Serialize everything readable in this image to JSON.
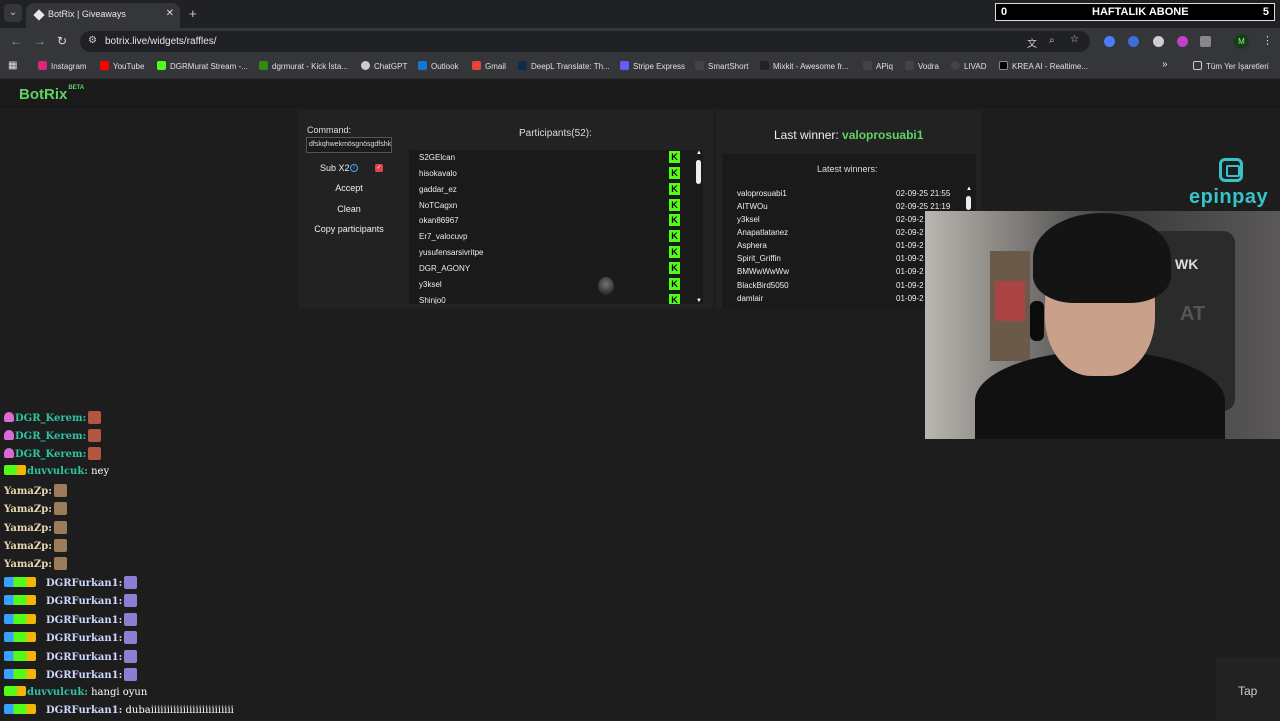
{
  "browser": {
    "tab_title": "BotRix | Giveaways",
    "url": "botrix.live/widgets/raffles/",
    "avatar_letter": "M",
    "bookmarks": [
      {
        "label": "Instagram",
        "color": "#d6297a"
      },
      {
        "label": "YouTube",
        "color": "#ff0000"
      },
      {
        "label": "DGRMurat Stream -...",
        "color": "#53fc18"
      },
      {
        "label": "dgrmurat - Kick İsta...",
        "color": "#53fc18"
      },
      {
        "label": "ChatGPT",
        "color": "#cccccc"
      },
      {
        "label": "Outlook",
        "color": "#0f78d4"
      },
      {
        "label": "Gmail",
        "color": "#ea4335"
      },
      {
        "label": "DeepL Translate: Th...",
        "color": "#0f2b46"
      },
      {
        "label": "Stripe Express",
        "color": "#635bff"
      },
      {
        "label": "SmartShort",
        "color": "#444444"
      },
      {
        "label": "Mixkit - Awesome fr...",
        "color": "#222222"
      },
      {
        "label": "APiq",
        "color": "#444444"
      },
      {
        "label": "Vodra",
        "color": "#444444"
      },
      {
        "label": "LIVAD",
        "color": "#444444"
      },
      {
        "label": "KREA AI - Realtime...",
        "color": "#000000"
      }
    ],
    "all_bookmarks": "Tüm Yer İşaretleri"
  },
  "sub_counter": {
    "left": "0",
    "title": "HAFTALIK ABONE",
    "right": "5"
  },
  "app": {
    "logo": "BotRix",
    "logo_badge": "BETA"
  },
  "raffle": {
    "command_label": "Command:",
    "command_value": "dfskqhwekmösgnösgdfshklk",
    "sub_x2_label": "Sub X2",
    "sub_x2_checked": true,
    "buttons": [
      "Accept",
      "Clean",
      "Copy participants"
    ],
    "participants_title": "Participants(52):",
    "participants": [
      "S2GElcan",
      "hisokavalo",
      "gaddar_ez",
      "NoTCagxn",
      "okan86967",
      "Er7_valocuvp",
      "yusufensarsivritpe",
      "DGR_AGONY",
      "y3ksel",
      "Shinjo0"
    ]
  },
  "winners": {
    "last_winner_label": "Last winner:",
    "last_winner": "valoprosuabi1",
    "latest_title": "Latest winners:",
    "list": [
      {
        "name": "valoprosuabi1",
        "date": "02-09-25 21:55"
      },
      {
        "name": "AITWOu",
        "date": "02-09-25 21:19"
      },
      {
        "name": "y3ksel",
        "date": "02-09-2"
      },
      {
        "name": "Anapatlatanez",
        "date": "02-09-2"
      },
      {
        "name": "Asphera",
        "date": "01-09-2"
      },
      {
        "name": "Spirit_Griffin",
        "date": "01-09-2"
      },
      {
        "name": "BMWwWwWw",
        "date": "01-09-2"
      },
      {
        "name": "BlackBird5050",
        "date": "01-09-2"
      },
      {
        "name": "damlair",
        "date": "01-09-2"
      }
    ]
  },
  "sponsor": {
    "name": "epinpay"
  },
  "webcam": {
    "chair_text": "WK",
    "chair_text2": "AT"
  },
  "chat": [
    {
      "badges": "heart",
      "user": "DGR_Kerem:",
      "color": "#2ec4a0",
      "msg": "",
      "emote": "#b3553f"
    },
    {
      "badges": "heart",
      "user": "DGR_Kerem:",
      "color": "#2ec4a0",
      "msg": "",
      "emote": "#b3553f"
    },
    {
      "badges": "heart",
      "user": "DGR_Kerem:",
      "color": "#2ec4a0",
      "msg": "",
      "emote": "#b3553f"
    },
    {
      "badges": "sub",
      "user": "duvvulcuk:",
      "color": "#2ec4a0",
      "msg": "ney",
      "emote": ""
    },
    {
      "badges": "",
      "user": "YamaZp:",
      "color": "#e8d7b0",
      "msg": "",
      "emote": "#9b7b5a"
    },
    {
      "badges": "",
      "user": "YamaZp:",
      "color": "#e8d7b0",
      "msg": "",
      "emote": "#9b7b5a"
    },
    {
      "badges": "",
      "user": "YamaZp:",
      "color": "#e8d7b0",
      "msg": "",
      "emote": "#9b7b5a"
    },
    {
      "badges": "",
      "user": "YamaZp:",
      "color": "#e8d7b0",
      "msg": "",
      "emote": "#9b7b5a"
    },
    {
      "badges": "",
      "user": "YamaZp:",
      "color": "#e8d7b0",
      "msg": "",
      "emote": "#9b7b5a"
    },
    {
      "badges": "mod-sub",
      "user": "DGRFurkan1:",
      "color": "#cfd6ff",
      "msg": "",
      "emote": "#8a7fd1"
    },
    {
      "badges": "mod-sub",
      "user": "DGRFurkan1:",
      "color": "#cfd6ff",
      "msg": "",
      "emote": "#8a7fd1"
    },
    {
      "badges": "mod-sub",
      "user": "DGRFurkan1:",
      "color": "#cfd6ff",
      "msg": "",
      "emote": "#8a7fd1"
    },
    {
      "badges": "mod-sub",
      "user": "DGRFurkan1:",
      "color": "#cfd6ff",
      "msg": "",
      "emote": "#8a7fd1"
    },
    {
      "badges": "mod-sub",
      "user": "DGRFurkan1:",
      "color": "#cfd6ff",
      "msg": "",
      "emote": "#8a7fd1"
    },
    {
      "badges": "mod-sub",
      "user": "DGRFurkan1:",
      "color": "#cfd6ff",
      "msg": "",
      "emote": "#8a7fd1"
    },
    {
      "badges": "sub",
      "user": "duvvulcuk:",
      "color": "#2ec4a0",
      "msg": "hangi oyun",
      "emote": ""
    },
    {
      "badges": "mod-sub",
      "user": "DGRFurkan1:",
      "color": "#cfd6ff",
      "msg": "dubaiiiiiiiiiiiiiiiiiiiiiiiiii",
      "emote": ""
    }
  ],
  "tap_label": "Tap",
  "colors": {
    "accent": "#5fd363",
    "kick": "#53fc18",
    "sponsor": "#35c3c8"
  }
}
